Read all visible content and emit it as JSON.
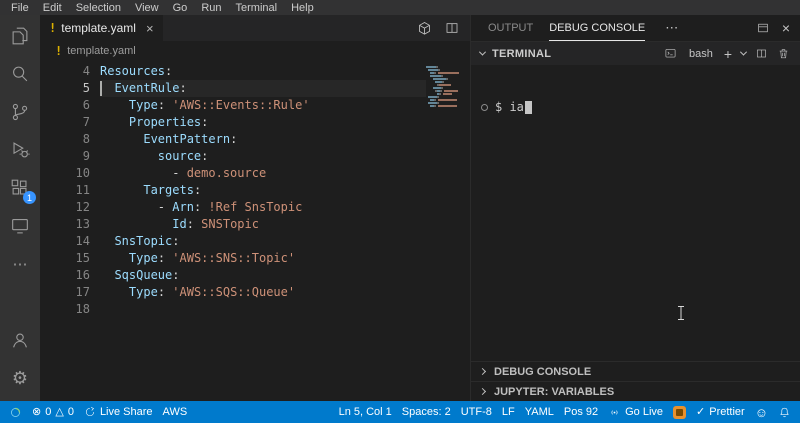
{
  "icons": {
    "close": "×",
    "more": "⋯",
    "plus": "+",
    "check": "✓",
    "smiley": "☺",
    "error": "⊗",
    "warning": "△",
    "gear": "⚙",
    "file_warning": "!",
    "named": [
      "files-icon",
      "search-icon",
      "source-control-icon",
      "run-debug-icon",
      "extensions-icon",
      "remote-explorer-icon",
      "more-icon",
      "account-icon",
      "settings-gear-icon",
      "cube-action-icon",
      "split-editor-icon",
      "maximize-panel-icon",
      "close-panel-icon",
      "bash-terminal-icon",
      "new-terminal-icon",
      "terminal-dropdown-icon",
      "split-terminal-icon",
      "trash-icon",
      "error-icon",
      "warning-icon",
      "live-share-icon",
      "go-live-broadcast-icon",
      "feedback-smiley-icon",
      "bell-icon"
    ]
  },
  "menubar": {
    "items": [
      "File",
      "Edit",
      "Selection",
      "View",
      "Go",
      "Run",
      "Terminal",
      "Help"
    ]
  },
  "activitybar": {
    "extensions_badge": "1"
  },
  "editor": {
    "tab": {
      "label": "template.yaml"
    },
    "breadcrumb": "template.yaml",
    "cursor_line": 5,
    "lines": [
      {
        "n": 4,
        "tokens": [
          [
            "key",
            "Resources"
          ],
          [
            "pun",
            ":"
          ]
        ]
      },
      {
        "n": 5,
        "tokens": [
          [
            "ws",
            "  "
          ],
          [
            "key",
            "EventRule"
          ],
          [
            "pun",
            ":"
          ]
        ]
      },
      {
        "n": 6,
        "tokens": [
          [
            "ws",
            "    "
          ],
          [
            "key",
            "Type"
          ],
          [
            "pun",
            ":"
          ],
          [
            "ws",
            " "
          ],
          [
            "str",
            "'AWS::Events::Rule'"
          ]
        ]
      },
      {
        "n": 7,
        "tokens": [
          [
            "ws",
            "    "
          ],
          [
            "key",
            "Properties"
          ],
          [
            "pun",
            ":"
          ]
        ]
      },
      {
        "n": 8,
        "tokens": [
          [
            "ws",
            "      "
          ],
          [
            "key",
            "EventPattern"
          ],
          [
            "pun",
            ":"
          ]
        ]
      },
      {
        "n": 9,
        "tokens": [
          [
            "ws",
            "        "
          ],
          [
            "key",
            "source"
          ],
          [
            "pun",
            ":"
          ]
        ]
      },
      {
        "n": 10,
        "tokens": [
          [
            "ws",
            "          "
          ],
          [
            "pun",
            "- "
          ],
          [
            "str",
            "demo.source"
          ]
        ]
      },
      {
        "n": 11,
        "tokens": [
          [
            "ws",
            "      "
          ],
          [
            "key",
            "Targets"
          ],
          [
            "pun",
            ":"
          ]
        ]
      },
      {
        "n": 12,
        "tokens": [
          [
            "ws",
            "        "
          ],
          [
            "pun",
            "- "
          ],
          [
            "key",
            "Arn"
          ],
          [
            "pun",
            ":"
          ],
          [
            "ws",
            " "
          ],
          [
            "str",
            "!Ref SnsTopic"
          ]
        ]
      },
      {
        "n": 13,
        "tokens": [
          [
            "ws",
            "          "
          ],
          [
            "key",
            "Id"
          ],
          [
            "pun",
            ":"
          ],
          [
            "ws",
            " "
          ],
          [
            "str",
            "SNSTopic"
          ]
        ]
      },
      {
        "n": 14,
        "tokens": [
          [
            "ws",
            "  "
          ],
          [
            "key",
            "SnsTopic"
          ],
          [
            "pun",
            ":"
          ]
        ]
      },
      {
        "n": 15,
        "tokens": [
          [
            "ws",
            "    "
          ],
          [
            "key",
            "Type"
          ],
          [
            "pun",
            ":"
          ],
          [
            "ws",
            " "
          ],
          [
            "str",
            "'AWS::SNS::Topic'"
          ]
        ]
      },
      {
        "n": 16,
        "tokens": [
          [
            "ws",
            "  "
          ],
          [
            "key",
            "SqsQueue"
          ],
          [
            "pun",
            ":"
          ]
        ]
      },
      {
        "n": 17,
        "tokens": [
          [
            "ws",
            "    "
          ],
          [
            "key",
            "Type"
          ],
          [
            "pun",
            ":"
          ],
          [
            "ws",
            " "
          ],
          [
            "str",
            "'AWS::SQS::Queue'"
          ]
        ]
      },
      {
        "n": 18,
        "tokens": []
      }
    ]
  },
  "panel": {
    "tabs": [
      {
        "label": "OUTPUT",
        "active": false
      },
      {
        "label": "DEBUG CONSOLE",
        "active": true
      }
    ],
    "terminal": {
      "title": "TERMINAL",
      "shell": "bash",
      "prompt": "$ ",
      "command": "ia"
    },
    "sections": [
      {
        "label": "DEBUG CONSOLE"
      },
      {
        "label": "JUPYTER: VARIABLES"
      }
    ]
  },
  "statusbar": {
    "errors": "0",
    "warnings": "0",
    "live_share": "Live Share",
    "aws": "AWS",
    "cursor": "Ln 5, Col 1",
    "indent": "Spaces: 2",
    "encoding": "UTF-8",
    "eol": "LF",
    "language": "YAML",
    "position": "Pos 92",
    "go_live": "Go Live",
    "formatter": "Prettier"
  },
  "colors": {
    "status_bar": "#007acc",
    "editor_bg": "#1e1e1e",
    "activity_bar": "#333333",
    "yaml_key": "#9cdcfe",
    "yaml_string": "#ce9178",
    "file_icon_warning": "#ddb100",
    "badge": "#3794ff",
    "orange_extension": "#e8912d"
  }
}
